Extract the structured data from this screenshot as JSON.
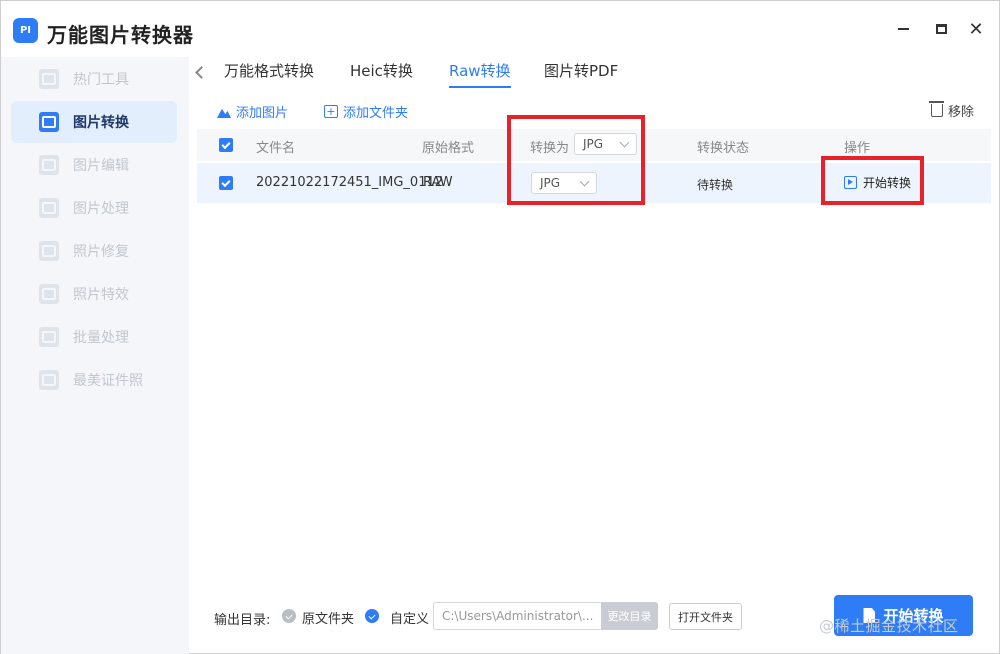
{
  "app": {
    "logo": "PI",
    "title": "万能图片转换器"
  },
  "window_controls": [
    "minimize-icon",
    "maximize-icon",
    "close-icon"
  ],
  "sidebar": {
    "items": [
      {
        "label": "热门工具",
        "icon": "grid-icon",
        "active": false
      },
      {
        "label": "图片转换",
        "icon": "image-convert-icon",
        "active": true
      },
      {
        "label": "图片编辑",
        "icon": "image-edit-icon",
        "active": false
      },
      {
        "label": "图片处理",
        "icon": "image-process-icon",
        "active": false
      },
      {
        "label": "照片修复",
        "icon": "photo-repair-icon",
        "active": false
      },
      {
        "label": "照片特效",
        "icon": "photo-effect-icon",
        "active": false
      },
      {
        "label": "批量处理",
        "icon": "batch-icon",
        "active": false
      },
      {
        "label": "最美证件照",
        "icon": "id-photo-icon",
        "active": false
      }
    ]
  },
  "tabs": [
    {
      "label": "万能格式转换",
      "active": false
    },
    {
      "label": "Heic转换",
      "active": false
    },
    {
      "label": "Raw转换",
      "active": true
    },
    {
      "label": "图片转PDF",
      "active": false
    }
  ],
  "toolbar": {
    "add_image": "添加图片",
    "add_folder": "添加文件夹",
    "remove": "移除"
  },
  "table": {
    "columns": {
      "filename": "文件名",
      "original_format": "原始格式",
      "convert_to": "转换为",
      "status": "转换状态",
      "action": "操作"
    },
    "header_format_value": "JPG",
    "rows": [
      {
        "filename": "20221022172451_IMG_0112",
        "original_format": "RAW",
        "target_format": "JPG",
        "status": "待转换",
        "action": "开始转换"
      }
    ]
  },
  "footer": {
    "output_label": "输出目录:",
    "option_original": "原文件夹",
    "option_custom": "自定义",
    "path_value": "C:\\Users\\Administrator\\...",
    "change_dir": "更改目录",
    "open_folder": "打开文件夹",
    "start_convert": "开始转换"
  },
  "watermark": "@稀土掘金技术社区",
  "colors": {
    "accent": "#2f7df6",
    "annotation": "#e8222b",
    "sidebar_bg": "#f4f6f9",
    "row_bg": "#eef4fe"
  }
}
